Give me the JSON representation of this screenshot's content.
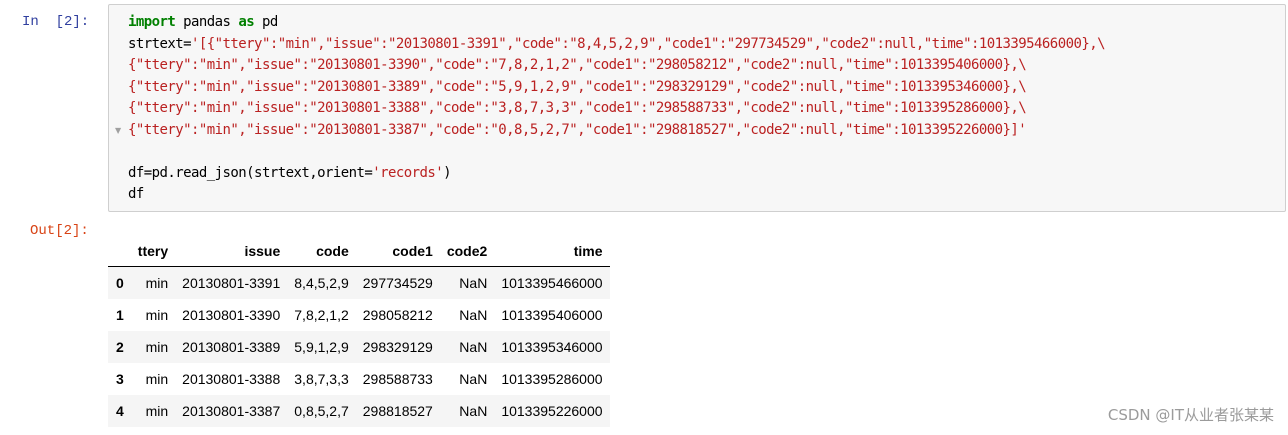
{
  "cell": {
    "in_prompt": "In  [2]:",
    "out_prompt": "Out[2]:"
  },
  "code": {
    "line1": {
      "kw1": "import",
      "mid": " pandas ",
      "kw2": "as",
      "end": " pd"
    },
    "line2": {
      "pre": "strtext=",
      "str": "'[{\"ttery\":\"min\",\"issue\":\"20130801-3391\",\"code\":\"8,4,5,2,9\",\"code1\":\"297734529\",\"code2\":null,\"time\":1013395466000},\\"
    },
    "line3": "{\"ttery\":\"min\",\"issue\":\"20130801-3390\",\"code\":\"7,8,2,1,2\",\"code1\":\"298058212\",\"code2\":null,\"time\":1013395406000},\\",
    "line4": "{\"ttery\":\"min\",\"issue\":\"20130801-3389\",\"code\":\"5,9,1,2,9\",\"code1\":\"298329129\",\"code2\":null,\"time\":1013395346000},\\",
    "line5": "{\"ttery\":\"min\",\"issue\":\"20130801-3388\",\"code\":\"3,8,7,3,3\",\"code1\":\"298588733\",\"code2\":null,\"time\":1013395286000},\\",
    "line6": "{\"ttery\":\"min\",\"issue\":\"20130801-3387\",\"code\":\"0,8,5,2,7\",\"code1\":\"298818527\",\"code2\":null,\"time\":1013395226000}]'",
    "line8": {
      "pre": "df=pd.read_json(strtext,orient=",
      "str": "'records'",
      "end": ")"
    },
    "line9": "df"
  },
  "table": {
    "columns": [
      "ttery",
      "issue",
      "code",
      "code1",
      "code2",
      "time"
    ],
    "rows": [
      {
        "index": "0",
        "cells": [
          "min",
          "20130801-3391",
          "8,4,5,2,9",
          "297734529",
          "NaN",
          "1013395466000"
        ]
      },
      {
        "index": "1",
        "cells": [
          "min",
          "20130801-3390",
          "7,8,2,1,2",
          "298058212",
          "NaN",
          "1013395406000"
        ]
      },
      {
        "index": "2",
        "cells": [
          "min",
          "20130801-3389",
          "5,9,1,2,9",
          "298329129",
          "NaN",
          "1013395346000"
        ]
      },
      {
        "index": "3",
        "cells": [
          "min",
          "20130801-3388",
          "3,8,7,3,3",
          "298588733",
          "NaN",
          "1013395286000"
        ]
      },
      {
        "index": "4",
        "cells": [
          "min",
          "20130801-3387",
          "0,8,5,2,7",
          "298818527",
          "NaN",
          "1013395226000"
        ]
      }
    ]
  },
  "watermark": "CSDN @IT从业者张某某",
  "icons": {
    "fold": "fold-arrow-icon"
  },
  "colors": {
    "prompt_in": "#303f9f",
    "prompt_out": "#d84315",
    "keyword": "#008000",
    "string": "#ba2121"
  }
}
